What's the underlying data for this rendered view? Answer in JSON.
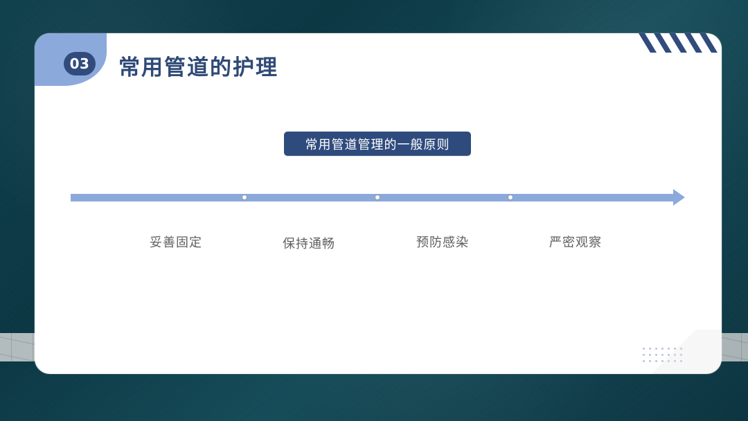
{
  "header": {
    "section_number": "03",
    "title": "常用管道的护理"
  },
  "content": {
    "heading": "常用管道管理的一般原则",
    "steps": [
      "妥善固定",
      "保持通畅",
      "预防感染",
      "严密观察"
    ]
  },
  "colors": {
    "primary": "#2f4b7d",
    "accent": "#8ca9dc",
    "text_muted": "#5f5f5f"
  }
}
